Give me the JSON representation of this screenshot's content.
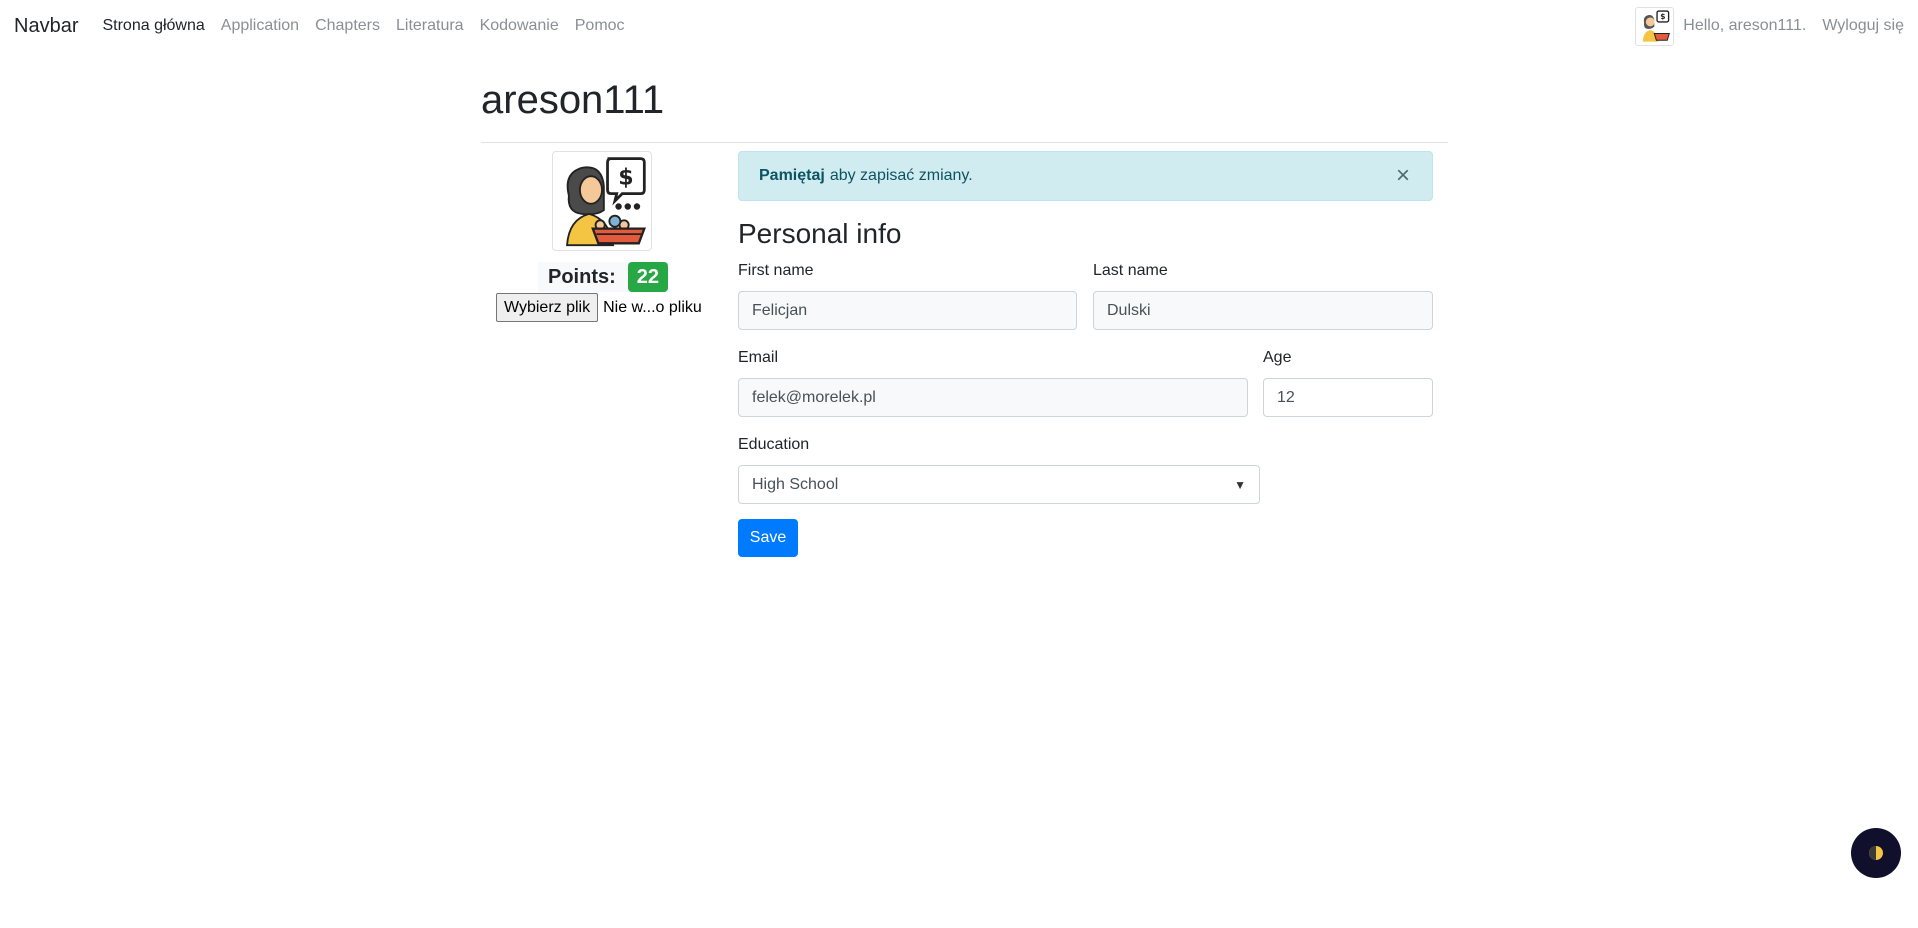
{
  "navbar": {
    "brand": "Navbar",
    "links": [
      {
        "label": "Strona główna",
        "active": true
      },
      {
        "label": "Application",
        "active": false
      },
      {
        "label": "Chapters",
        "active": false
      },
      {
        "label": "Literatura",
        "active": false
      },
      {
        "label": "Kodowanie",
        "active": false
      },
      {
        "label": "Pomoc",
        "active": false
      }
    ],
    "avatar_icon": "user-avatar-icon",
    "greeting": "Hello, areson111.",
    "logout": "Wyloguj się"
  },
  "profile": {
    "username": "areson111",
    "avatar_icon": "woman-shopping-basket-icon",
    "points_label": "Points:",
    "points_value": "22",
    "file_button": "Wybierz plik",
    "file_status": "Nie w...o pliku"
  },
  "alert": {
    "strong": "Pamiętaj",
    "text": "aby zapisać zmiany.",
    "close": "×"
  },
  "form": {
    "section_title": "Personal info",
    "first_name_label": "First name",
    "first_name_value": "Felicjan",
    "last_name_label": "Last name",
    "last_name_value": "Dulski",
    "email_label": "Email",
    "email_value": "felek@morelek.pl",
    "age_label": "Age",
    "age_value": "12",
    "education_label": "Education",
    "education_value": "High School",
    "save": "Save"
  },
  "colors": {
    "primary": "#007bff",
    "success": "#28a745",
    "alert_bg": "#d1ecf1",
    "toggle_bg": "#100f2c"
  }
}
